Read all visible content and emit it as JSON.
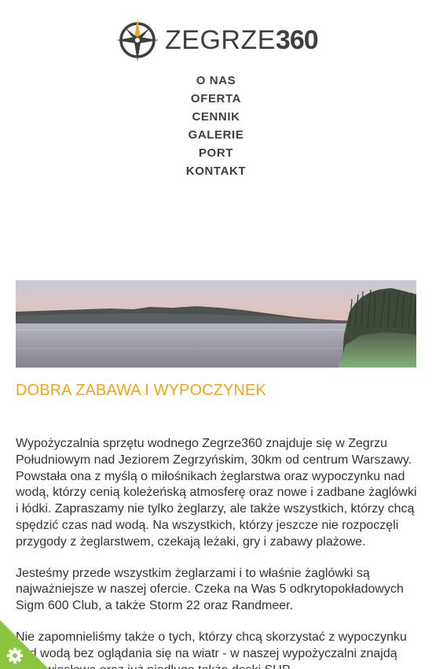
{
  "brand": {
    "name_light": "ZEGRZE",
    "name_bold": "360"
  },
  "nav": {
    "items": [
      {
        "label": "O NAS"
      },
      {
        "label": "OFERTA"
      },
      {
        "label": "CENNIK"
      },
      {
        "label": "GALERIE"
      },
      {
        "label": "PORT"
      },
      {
        "label": "KONTAKT"
      }
    ]
  },
  "main": {
    "heading": "DOBRA ZABAWA I WYPOCZYNEK",
    "paragraphs": [
      "Wypożyczalnia sprzętu wodnego Zegrze360 znajduje się w Zegrzu Południowym nad Jeziorem Zegrzyńskim, 30km od centrum Warszawy. Powstała ona z myślą o miłośnikach żeglarstwa oraz wypoczynku nad wodą, którzy cenią koleżeńską atmosferę oraz nowe i zadbane żaglówki i łódki. Zapraszamy nie tylko żeglarzy, ale także wszystkich, którzy chcą spędzić czas nad wodą. Na wszystkich, którzy jeszcze nie rozpoczęli przygody z żeglarstwem, czekają leżaki, gry i zabawy plażowe.",
      "Jesteśmy przede wszystkim żeglarzami i to właśnie żaglówki są najważniejsze w naszej ofercie. Czeka na Was 5 odkrytopokładowych Sigm 600 Club, a także Storm 22 oraz Randmeer.",
      "Nie zapomnieliśmy także o tych, którzy chcą skorzystać z wypoczynku nad wodą bez oglądania się na wiatr - w naszej wypożyczalni znajdą łódki wiosłowe oraz już niedługo także deski SUP."
    ]
  },
  "colors": {
    "accent": "#f2a51a",
    "text": "#333333",
    "nav": "#3f3f3f",
    "cookie_badge": "#8cc63f"
  },
  "icons": {
    "logo": "compass-rose-icon",
    "cookie": "gear-icon"
  }
}
